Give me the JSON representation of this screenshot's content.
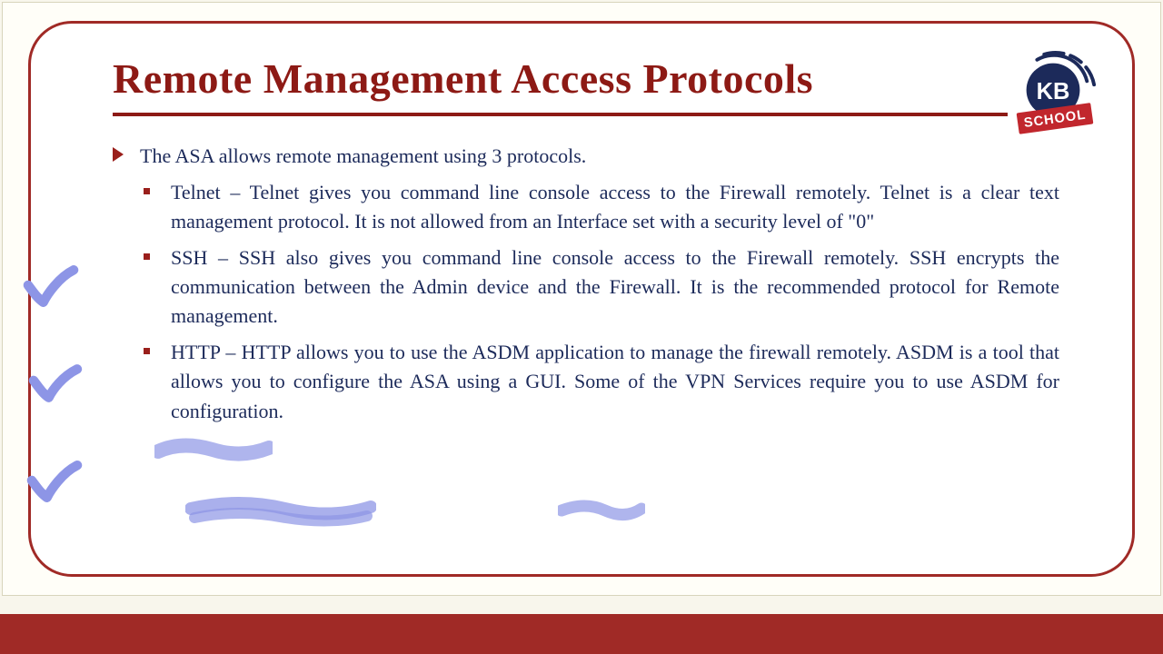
{
  "title": "Remote Management Access Protocols",
  "lead": "The ASA allows remote management using 3 protocols.",
  "items": [
    "Telnet – Telnet gives you command line console access to the Firewall remotely. Telnet is a clear text management protocol. It is not allowed from an Interface set with a security level of \"0\"",
    "SSH – SSH also gives you command line console access to the Firewall remotely. SSH encrypts the communication between the Admin device and the Firewall. It is the recommended protocol for Remote management.",
    "HTTP – HTTP allows you to use the ASDM application to manage the firewall remotely. ASDM is a tool that allows you to configure the ASA using a GUI. Some of the VPN Services require you to use ASDM for configuration."
  ],
  "brand": {
    "kb": "KB",
    "school": "SCHOOL"
  },
  "colors": {
    "accent": "#a02a26",
    "ink": "#1c2a5a",
    "hl": "#8d95e6"
  }
}
